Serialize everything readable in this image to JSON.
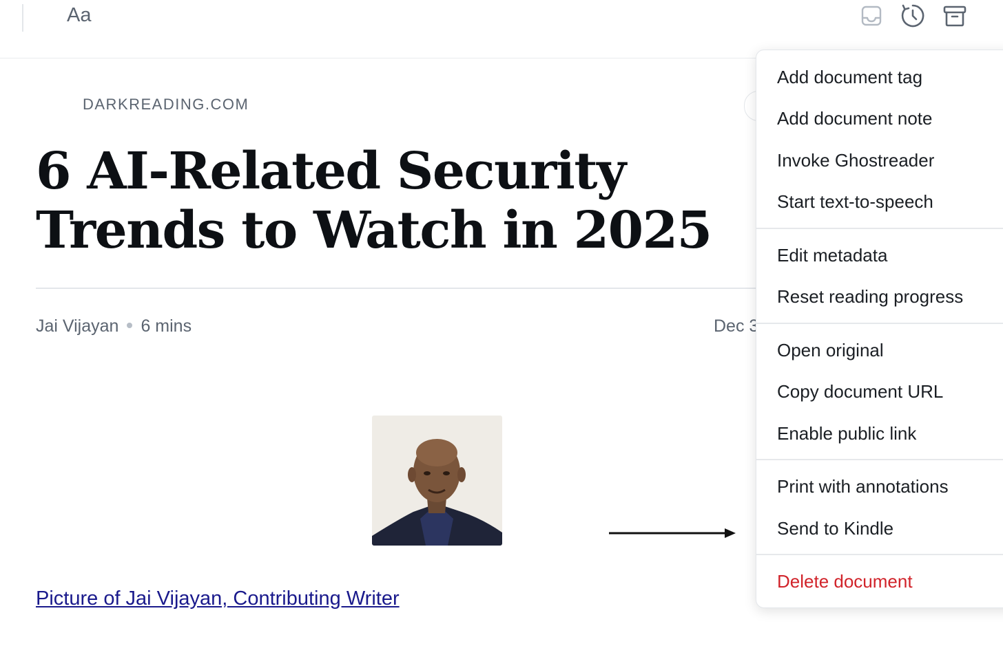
{
  "toolbar": {
    "font_button_label": "Aa",
    "icons": [
      "inbox-icon",
      "later-clock-icon",
      "archive-icon"
    ]
  },
  "article": {
    "domain": "DARKREADING.COM",
    "title_line1": "6 AI-Related Security",
    "title_line2": "Trends to Watch in 2025",
    "author": "Jai Vijayan",
    "read_time": "6 mins",
    "date": "Dec 3",
    "caption_link": "Picture of Jai Vijayan, Contributing Writer"
  },
  "menu": {
    "groups": [
      [
        "Add document tag",
        "Add document note",
        "Invoke Ghostreader",
        "Start text-to-speech"
      ],
      [
        "Edit metadata",
        "Reset reading progress"
      ],
      [
        "Open original",
        "Copy document URL",
        "Enable public link"
      ],
      [
        "Print with annotations",
        "Send to Kindle"
      ],
      [
        "Delete document"
      ]
    ]
  },
  "colors": {
    "accent_text": "#0d1014",
    "muted_text": "#5b6470",
    "link": "#1a1a8c",
    "danger": "#d1232a"
  }
}
